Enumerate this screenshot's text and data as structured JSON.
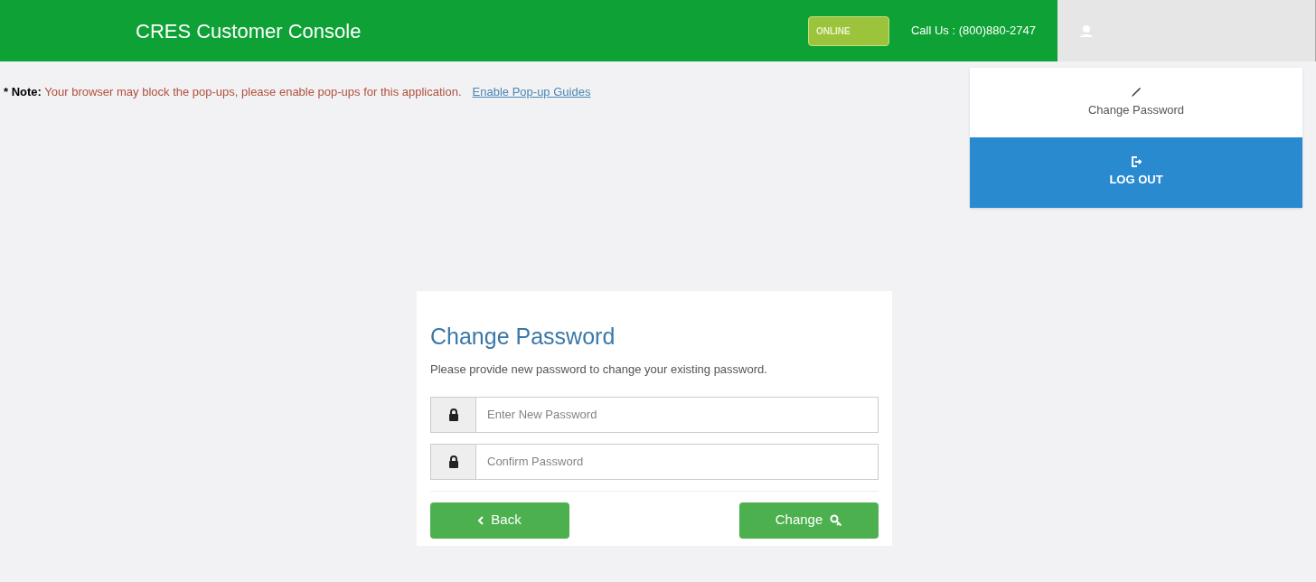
{
  "header": {
    "title": "CRES Customer Console",
    "status_badge": "ONLINE",
    "phone": "Call Us : (800)880-2747"
  },
  "user_menu": {
    "expanded": true,
    "items": [
      {
        "kind": "link",
        "label": "Change Password"
      },
      {
        "kind": "logout",
        "label": "LOG OUT"
      }
    ]
  },
  "note": {
    "label": "* Note:",
    "message": "Your browser may block the pop-ups, please enable pop-ups for this application.",
    "link": "Enable Pop-up Guides"
  },
  "form": {
    "title": "Change Password",
    "description": "Please provide new password to change your existing password.",
    "fields": [
      {
        "placeholder": "Enter New Password"
      },
      {
        "placeholder": "Confirm Password"
      }
    ],
    "buttons": [
      {
        "kind": "back",
        "label": "Back"
      },
      {
        "kind": "submit",
        "label": "Change"
      }
    ]
  }
}
